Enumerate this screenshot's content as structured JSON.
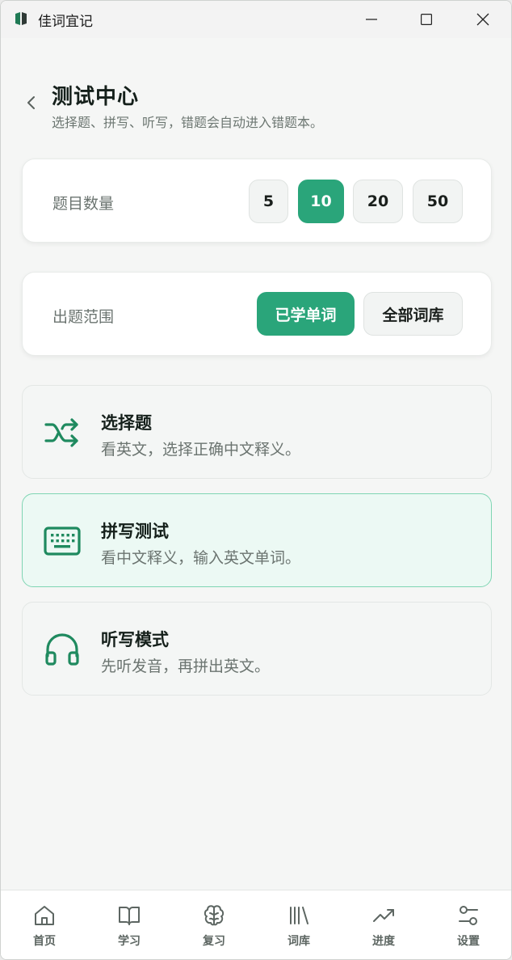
{
  "window": {
    "title": "佳词宜记"
  },
  "header": {
    "title": "测试中心",
    "subtitle": "选择题、拼写、听写，错题会自动进入错题本。"
  },
  "question_count": {
    "label": "题目数量",
    "options": [
      "5",
      "10",
      "20",
      "50"
    ],
    "selected": "10"
  },
  "scope": {
    "label": "出题范围",
    "options": [
      "已学单词",
      "全部词库"
    ],
    "selected": "已学单词"
  },
  "modes": [
    {
      "title": "选择题",
      "desc": "看英文，选择正确中文释义。",
      "icon": "shuffle-icon"
    },
    {
      "title": "拼写测试",
      "desc": "看中文释义，输入英文单词。",
      "icon": "keyboard-icon",
      "selected": true
    },
    {
      "title": "听写模式",
      "desc": "先听发音，再拼出英文。",
      "icon": "headphones-icon"
    }
  ],
  "nav": [
    {
      "label": "首页",
      "icon": "home-icon"
    },
    {
      "label": "学习",
      "icon": "book-icon"
    },
    {
      "label": "复习",
      "icon": "brain-icon"
    },
    {
      "label": "词库",
      "icon": "library-icon"
    },
    {
      "label": "进度",
      "icon": "trending-icon"
    },
    {
      "label": "设置",
      "icon": "sliders-icon"
    }
  ],
  "colors": {
    "accent": "#2aa57a",
    "icon": "#1f8a5f"
  }
}
